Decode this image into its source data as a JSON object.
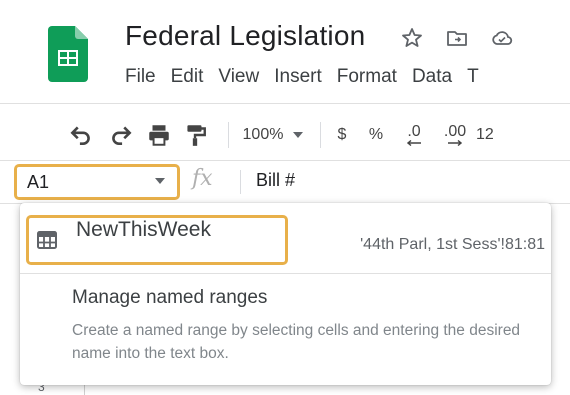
{
  "header": {
    "title": "Federal Legislation",
    "menu": [
      "File",
      "Edit",
      "View",
      "Insert",
      "Format",
      "Data",
      "T"
    ]
  },
  "toolbar": {
    "zoom": "100%",
    "currency": "$",
    "percent": "%",
    "decrease_decimal": ".0",
    "increase_decimal": ".00",
    "more_formats": "12"
  },
  "formula_bar": {
    "cell_ref": "A1",
    "fx": "fx",
    "content": "Bill #"
  },
  "named_ranges": {
    "items": [
      {
        "name": "NewThisWeek",
        "range": "'44th Parl, 1st Sess'!81:81"
      }
    ],
    "manage_label": "Manage named ranges",
    "help_text": "Create a named range by selecting cells and entering the desired name into the text box."
  },
  "sheet": {
    "visible_row": "3"
  },
  "colors": {
    "highlight": "#e8b04a",
    "sheets_green": "#0f9d58"
  }
}
